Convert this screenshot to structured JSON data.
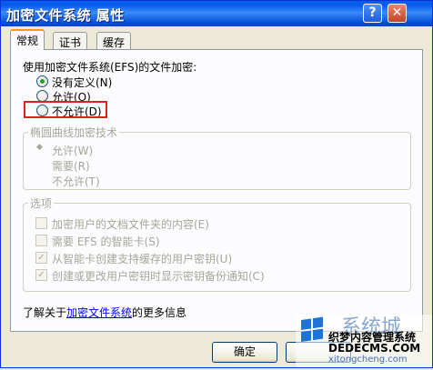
{
  "window": {
    "title": "加密文件系统 属性",
    "help_label": "?",
    "close_label": "✕"
  },
  "tabs": [
    {
      "label": "常规",
      "active": true
    },
    {
      "label": "证书",
      "active": false
    },
    {
      "label": "缓存",
      "active": false
    }
  ],
  "efs": {
    "heading": "使用加密文件系统(EFS)的文件加密:",
    "options": [
      {
        "label": "没有定义(N)",
        "checked": true
      },
      {
        "label": "允许(O)",
        "checked": false
      },
      {
        "label": "不允许(D)",
        "checked": false
      }
    ]
  },
  "ecc": {
    "legend": "椭圆曲线加密技术",
    "options": [
      {
        "label": "允许(W)"
      },
      {
        "label": "需要(R)"
      },
      {
        "label": "不允许(T)"
      }
    ]
  },
  "options_group": {
    "legend": "选项",
    "items": [
      {
        "label": "加密用户的文档文件夹的内容(E)",
        "checked": false
      },
      {
        "label": "需要 EFS 的智能卡(S)",
        "checked": false
      },
      {
        "label": "从智能卡创建支持缓存的用户密钥(U)",
        "checked": true
      },
      {
        "label": "创建或更改用户密钥时显示密钥备份通知(C)",
        "checked": true
      }
    ]
  },
  "info": {
    "prefix": "了解关于",
    "link": "加密文件系统",
    "suffix": "的更多信息"
  },
  "buttons": {
    "ok": "确定"
  },
  "watermark": {
    "line1": "系统城",
    "line2": "织梦内容管理系统",
    "line3": "DEDECMS.COM",
    "line4": "xitongcheng.com"
  }
}
